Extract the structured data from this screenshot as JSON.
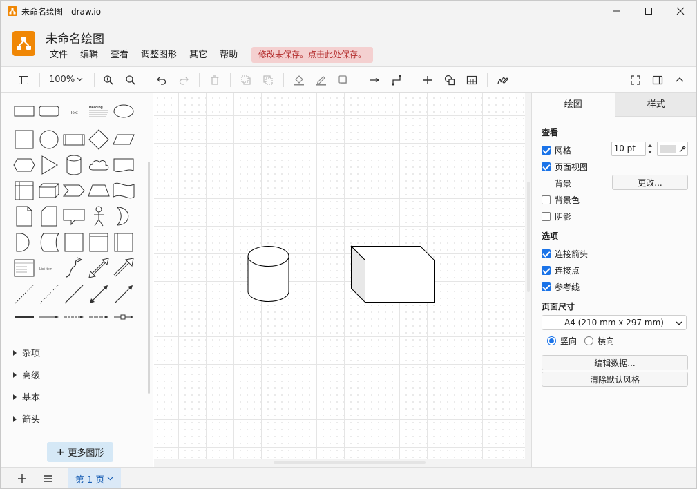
{
  "window": {
    "title": "未命名绘图 - draw.io"
  },
  "header": {
    "doc_title": "未命名绘图",
    "menu": [
      "文件",
      "编辑",
      "查看",
      "调整图形",
      "其它",
      "帮助"
    ],
    "unsaved_notice": "修改未保存。点击此处保存。"
  },
  "toolbar": {
    "zoom": "100%"
  },
  "left_panel": {
    "categories": [
      "杂项",
      "高级",
      "基本",
      "箭头"
    ],
    "more_shapes_label": "更多图形",
    "shape_text_sample": "Text",
    "shape_heading_sample": "Heading",
    "shape_list_sample": "List Item"
  },
  "right_panel": {
    "tabs": [
      "绘图",
      "样式"
    ],
    "view": {
      "title": "查看",
      "grid": "网格",
      "grid_size": "10 pt",
      "page_view": "页面视图",
      "background": "背景",
      "change_button": "更改...",
      "background_color": "背景色",
      "shadow": "阴影"
    },
    "options": {
      "title": "选项",
      "connection_arrows": "连接箭头",
      "connection_points": "连接点",
      "guides": "参考线"
    },
    "page_size": {
      "title": "页面尺寸",
      "selected": "A4 (210 mm x 297 mm)",
      "portrait": "竖向",
      "landscape": "横向"
    },
    "edit_data_button": "编辑数据...",
    "clear_style_button": "清除默认风格"
  },
  "bottom_bar": {
    "page_tab": "第 1 页"
  },
  "colors": {
    "brand": "#f08705",
    "accent": "#1a73e8",
    "unsaved_bg": "#f4d0d0",
    "unsaved_fg": "#b32d2d"
  }
}
